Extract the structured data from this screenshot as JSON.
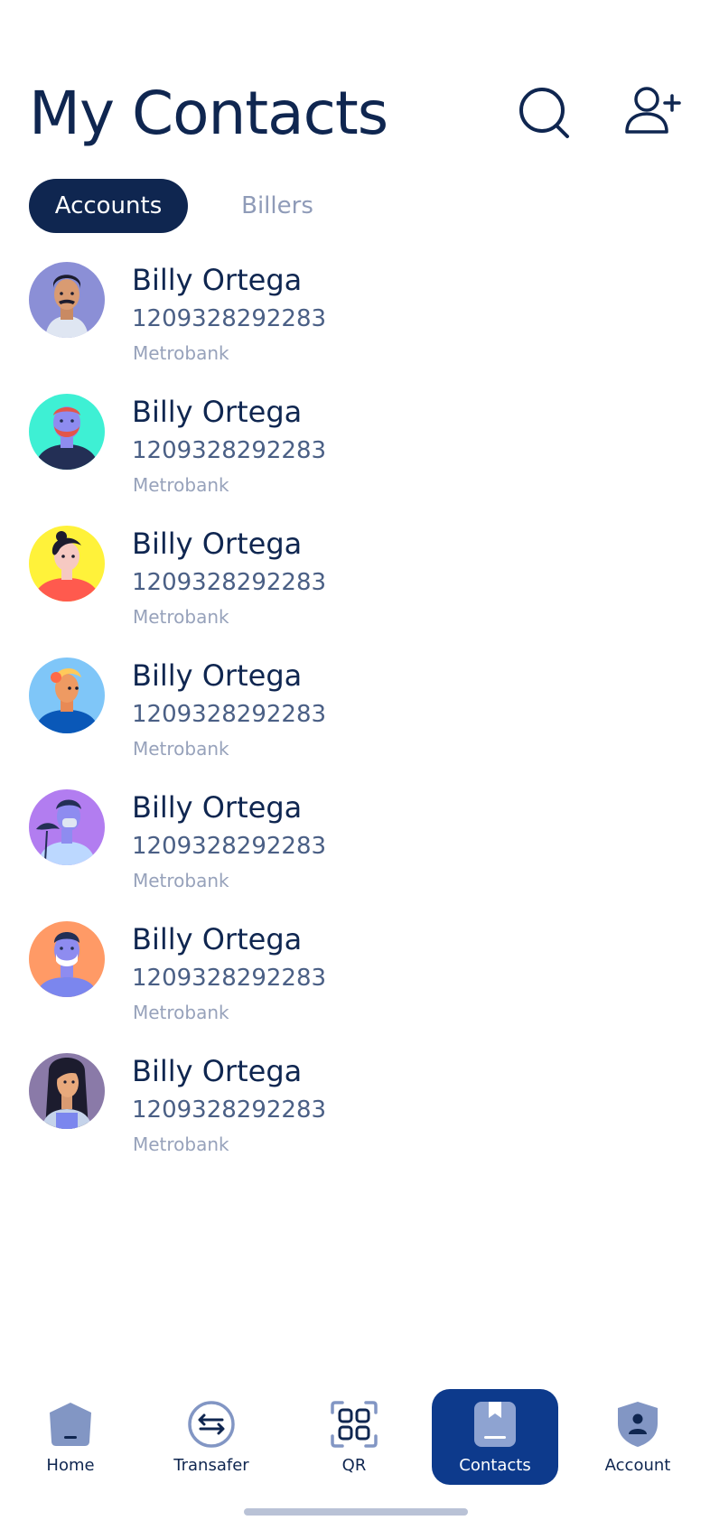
{
  "header": {
    "title": "My Contacts",
    "search_icon": "search-icon",
    "add_contact_icon": "user-plus-icon"
  },
  "tabs": [
    {
      "label": "Accounts",
      "active": true
    },
    {
      "label": "Billers",
      "active": false
    }
  ],
  "contacts": [
    {
      "name": "Billy Ortega",
      "number": "1209328292283",
      "bank": "Metrobank",
      "avatar_bg": "#8b8fd6"
    },
    {
      "name": "Billy Ortega",
      "number": "1209328292283",
      "bank": "Metrobank",
      "avatar_bg": "#3ef0d4"
    },
    {
      "name": "Billy Ortega",
      "number": "1209328292283",
      "bank": "Metrobank",
      "avatar_bg": "#fff23a"
    },
    {
      "name": "Billy Ortega",
      "number": "1209328292283",
      "bank": "Metrobank",
      "avatar_bg": "#7fc6f8"
    },
    {
      "name": "Billy Ortega",
      "number": "1209328292283",
      "bank": "Metrobank",
      "avatar_bg": "#b27df0"
    },
    {
      "name": "Billy Ortega",
      "number": "1209328292283",
      "bank": "Metrobank",
      "avatar_bg": "#ff9a66"
    },
    {
      "name": "Billy Ortega",
      "number": "1209328292283",
      "bank": "Metrobank",
      "avatar_bg": "#8a7aa8"
    }
  ],
  "bottom_nav": [
    {
      "label": "Home",
      "icon": "home-icon",
      "active": false
    },
    {
      "label": "Transafer",
      "icon": "transfer-icon",
      "active": false
    },
    {
      "label": "QR",
      "icon": "qr-icon",
      "active": false
    },
    {
      "label": "Contacts",
      "icon": "contacts-book-icon",
      "active": true
    },
    {
      "label": "Account",
      "icon": "account-shield-icon",
      "active": false
    }
  ],
  "colors": {
    "primary": "#0f2650",
    "active_nav": "#0d3a8c",
    "muted": "#97a2bb"
  }
}
